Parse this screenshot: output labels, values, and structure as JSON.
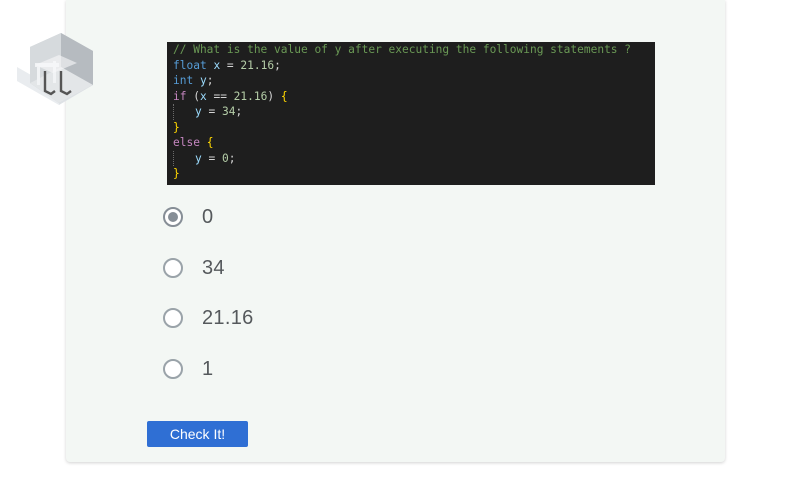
{
  "question": {
    "code_lines": [
      [
        {
          "t": "// What is the value of y after executing the following statements ?",
          "c": "tok-comment"
        }
      ],
      [
        {
          "t": "float",
          "c": "tok-kw"
        },
        {
          "t": " ",
          "c": "tok-op"
        },
        {
          "t": "x",
          "c": "tok-var"
        },
        {
          "t": " = ",
          "c": "tok-op"
        },
        {
          "t": "21.16",
          "c": "tok-num"
        },
        {
          "t": ";",
          "c": "tok-op"
        }
      ],
      [
        {
          "t": "int",
          "c": "tok-kw"
        },
        {
          "t": " ",
          "c": "tok-op"
        },
        {
          "t": "y",
          "c": "tok-var"
        },
        {
          "t": ";",
          "c": "tok-op"
        }
      ],
      [
        {
          "t": "if",
          "c": "tok-ctrl"
        },
        {
          "t": " (",
          "c": "tok-op"
        },
        {
          "t": "x",
          "c": "tok-var"
        },
        {
          "t": " == ",
          "c": "tok-op"
        },
        {
          "t": "21.16",
          "c": "tok-num"
        },
        {
          "t": ") ",
          "c": "tok-op"
        },
        {
          "t": "{",
          "c": "tok-brace"
        }
      ],
      [
        {
          "guide": true
        },
        {
          "t": "y",
          "c": "tok-var"
        },
        {
          "t": " = ",
          "c": "tok-op"
        },
        {
          "t": "34",
          "c": "tok-num"
        },
        {
          "t": ";",
          "c": "tok-op"
        }
      ],
      [
        {
          "t": "}",
          "c": "tok-brace"
        }
      ],
      [
        {
          "t": "else",
          "c": "tok-ctrl"
        },
        {
          "t": " ",
          "c": "tok-op"
        },
        {
          "t": "{",
          "c": "tok-brace"
        }
      ],
      [
        {
          "guide": true
        },
        {
          "t": "y",
          "c": "tok-var"
        },
        {
          "t": " = ",
          "c": "tok-op"
        },
        {
          "t": "0",
          "c": "tok-num"
        },
        {
          "t": ";",
          "c": "tok-op"
        }
      ],
      [
        {
          "t": "}",
          "c": "tok-brace"
        }
      ]
    ]
  },
  "options": [
    {
      "label": "0",
      "checked": true
    },
    {
      "label": "34",
      "checked": false
    },
    {
      "label": "21.16",
      "checked": false
    },
    {
      "label": "1",
      "checked": false
    }
  ],
  "submit_label": "Check It!",
  "icons": {
    "logo": "isometric-room-logo-icon"
  },
  "colors": {
    "accent": "#2f6fd4",
    "card_bg": "#f3f7f4",
    "code_bg": "#1e1e1e"
  }
}
